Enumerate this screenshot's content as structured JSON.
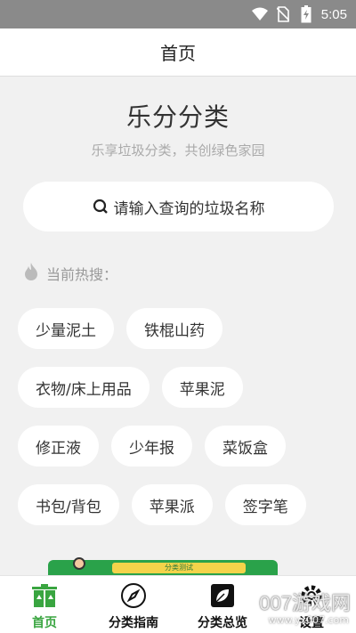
{
  "status_bar": {
    "time": "5:05",
    "icons": [
      "wifi-icon",
      "no-sim-icon",
      "battery-charging-icon"
    ]
  },
  "header": {
    "title": "首页"
  },
  "hero": {
    "app_name": "乐分分类",
    "slogan": "乐享垃圾分类，共创绿色家园"
  },
  "search": {
    "placeholder": "请输入查询的垃圾名称",
    "icon": "search-icon"
  },
  "hot": {
    "label": "当前热搜：",
    "icon": "fire-icon",
    "rows": [
      [
        "少量泥土",
        "铁棍山药"
      ],
      [
        "衣物/床上用品",
        "苹果泥"
      ],
      [
        "修正液",
        "少年报",
        "菜饭盒"
      ],
      [
        "书包/背包",
        "苹果派",
        "签字笔"
      ]
    ]
  },
  "banner": {
    "strip_text": "分类测试"
  },
  "tab_bar": {
    "active_color": "#39a540",
    "tabs": [
      {
        "label": "首页",
        "icon": "trash-bins-icon",
        "active": true
      },
      {
        "label": "分类指南",
        "icon": "compass-icon",
        "active": false
      },
      {
        "label": "分类总览",
        "icon": "leaf-icon",
        "active": false
      },
      {
        "label": "设置",
        "icon": "gear-icon",
        "active": false
      }
    ]
  },
  "watermark": {
    "text": "007游戏网",
    "url": "www.yx007.com"
  }
}
